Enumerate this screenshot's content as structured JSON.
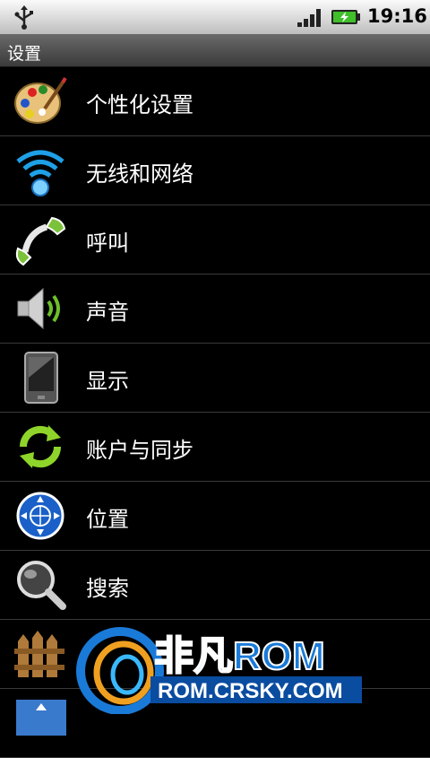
{
  "status": {
    "time": "19:16"
  },
  "title": "设置",
  "items": [
    {
      "label": "个性化设置",
      "icon": "palette-icon"
    },
    {
      "label": "无线和网络",
      "icon": "wifi-icon"
    },
    {
      "label": "呼叫",
      "icon": "phone-icon"
    },
    {
      "label": "声音",
      "icon": "speaker-icon"
    },
    {
      "label": "显示",
      "icon": "display-icon"
    },
    {
      "label": "账户与同步",
      "icon": "sync-icon"
    },
    {
      "label": "位置",
      "icon": "location-icon"
    },
    {
      "label": "搜索",
      "icon": "search-icon"
    },
    {
      "label": "",
      "icon": "fence-icon"
    },
    {
      "label": "",
      "icon": "app-icon"
    }
  ],
  "watermark": {
    "brand": "非凡ROM",
    "url": "ROM.CRSKY.COM"
  }
}
